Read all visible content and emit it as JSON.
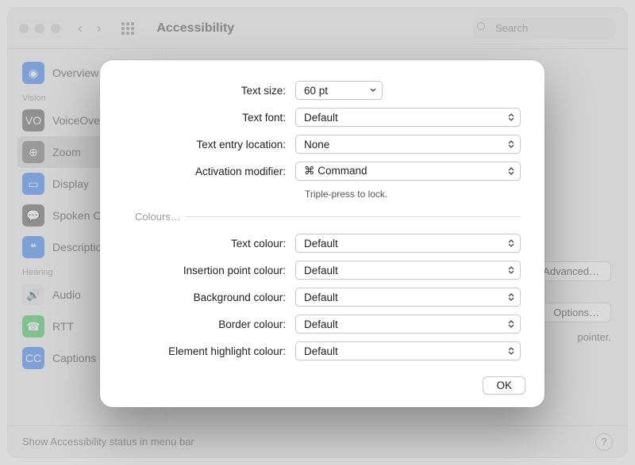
{
  "window": {
    "title": "Accessibility",
    "search_placeholder": "Search"
  },
  "sidebar": {
    "items": [
      {
        "label": "Overview",
        "icon_color": "#2f7df6"
      },
      {
        "section": "Vision"
      },
      {
        "label": "VoiceOver",
        "icon_color": "#5a5a5a"
      },
      {
        "label": "Zoom",
        "icon_color": "#6f6f6f",
        "selected": true
      },
      {
        "label": "Display",
        "icon_color": "#2f7df6"
      },
      {
        "label": "Spoken Content",
        "icon_color": "#5a5a5a"
      },
      {
        "label": "Descriptions",
        "icon_color": "#2f7df6"
      },
      {
        "section": "Hearing"
      },
      {
        "label": "Audio",
        "icon_color": "#8e8e8e"
      },
      {
        "label": "RTT",
        "icon_color": "#34c759"
      },
      {
        "label": "Captions",
        "icon_color": "#2f7df6"
      }
    ]
  },
  "bg_right": {
    "advanced_btn": "Advanced…",
    "options_btn": "Options…",
    "pointer_text": "pointer."
  },
  "footer": {
    "menubar_text": "Show Accessibility status in menu bar",
    "help_glyph": "?"
  },
  "sheet": {
    "rows": {
      "text_size": {
        "label": "Text size:",
        "value": "60 pt"
      },
      "text_font": {
        "label": "Text font:",
        "value": "Default"
      },
      "entry_loc": {
        "label": "Text entry location:",
        "value": "None"
      },
      "activation": {
        "label": "Activation modifier:",
        "value": "⌘ Command",
        "hint": "Triple-press to lock."
      }
    },
    "colours_section": "Colours…",
    "colour_rows": {
      "text": {
        "label": "Text colour:",
        "value": "Default"
      },
      "insertion": {
        "label": "Insertion point colour:",
        "value": "Default"
      },
      "background": {
        "label": "Background colour:",
        "value": "Default"
      },
      "border": {
        "label": "Border colour:",
        "value": "Default"
      },
      "highlight": {
        "label": "Element highlight colour:",
        "value": "Default"
      }
    },
    "ok_label": "OK"
  }
}
